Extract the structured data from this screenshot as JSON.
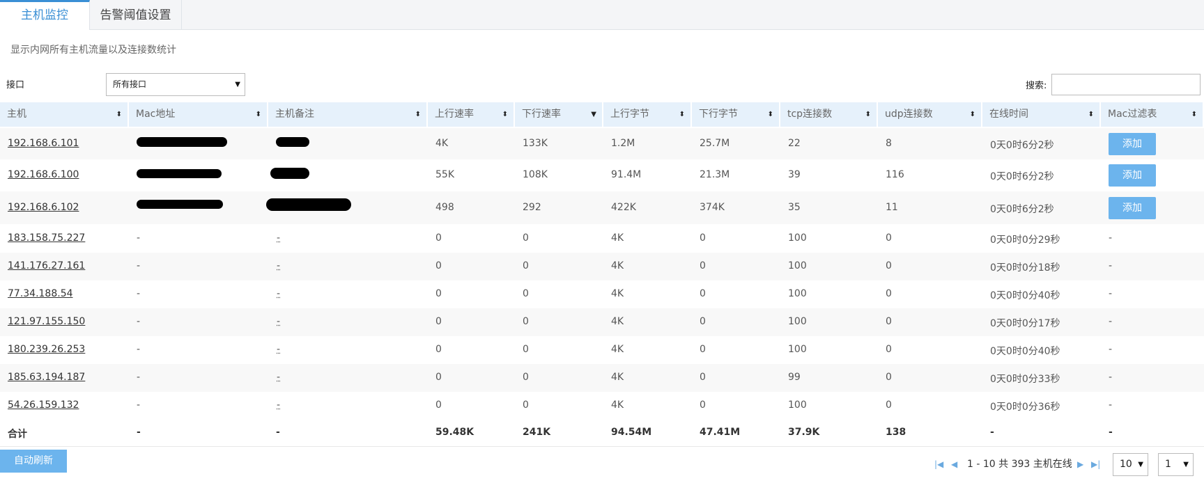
{
  "tabs": [
    {
      "label": "主机监控",
      "active": true
    },
    {
      "label": "告警阈值设置",
      "active": false
    }
  ],
  "description": "显示内网所有主机流量以及连接数统计",
  "filters": {
    "interface_label": "接口",
    "interface_value": "所有接口",
    "search_label": "搜索:",
    "search_value": ""
  },
  "columns": [
    "主机",
    "Mac地址",
    "主机备注",
    "上行速率",
    "下行速率",
    "上行字节",
    "下行字节",
    "tcp连接数",
    "udp连接数",
    "在线时间",
    "Mac过滤表"
  ],
  "rows": [
    {
      "host": "192.168.6.101",
      "mac": "",
      "note": "",
      "up_rate": "4K",
      "down_rate": "133K",
      "up_bytes": "1.2M",
      "down_bytes": "25.7M",
      "tcp": "22",
      "udp": "8",
      "online": "0天0时6分2秒",
      "mac_filter": "添加"
    },
    {
      "host": "192.168.6.100",
      "mac": "",
      "note": "",
      "up_rate": "55K",
      "down_rate": "108K",
      "up_bytes": "91.4M",
      "down_bytes": "21.3M",
      "tcp": "39",
      "udp": "116",
      "online": "0天0时6分2秒",
      "mac_filter": "添加"
    },
    {
      "host": "192.168.6.102",
      "mac": "",
      "note": "",
      "up_rate": "498",
      "down_rate": "292",
      "up_bytes": "422K",
      "down_bytes": "374K",
      "tcp": "35",
      "udp": "11",
      "online": "0天0时6分2秒",
      "mac_filter": "添加"
    },
    {
      "host": "183.158.75.227",
      "mac": "-",
      "note": "-",
      "up_rate": "0",
      "down_rate": "0",
      "up_bytes": "4K",
      "down_bytes": "0",
      "tcp": "100",
      "udp": "0",
      "online": "0天0时0分29秒",
      "mac_filter": "-"
    },
    {
      "host": "141.176.27.161",
      "mac": "-",
      "note": "-",
      "up_rate": "0",
      "down_rate": "0",
      "up_bytes": "4K",
      "down_bytes": "0",
      "tcp": "100",
      "udp": "0",
      "online": "0天0时0分18秒",
      "mac_filter": "-"
    },
    {
      "host": "77.34.188.54",
      "mac": "-",
      "note": "-",
      "up_rate": "0",
      "down_rate": "0",
      "up_bytes": "4K",
      "down_bytes": "0",
      "tcp": "100",
      "udp": "0",
      "online": "0天0时0分40秒",
      "mac_filter": "-"
    },
    {
      "host": "121.97.155.150",
      "mac": "-",
      "note": "-",
      "up_rate": "0",
      "down_rate": "0",
      "up_bytes": "4K",
      "down_bytes": "0",
      "tcp": "100",
      "udp": "0",
      "online": "0天0时0分17秒",
      "mac_filter": "-"
    },
    {
      "host": "180.239.26.253",
      "mac": "-",
      "note": "-",
      "up_rate": "0",
      "down_rate": "0",
      "up_bytes": "4K",
      "down_bytes": "0",
      "tcp": "100",
      "udp": "0",
      "online": "0天0时0分40秒",
      "mac_filter": "-"
    },
    {
      "host": "185.63.194.187",
      "mac": "-",
      "note": "-",
      "up_rate": "0",
      "down_rate": "0",
      "up_bytes": "4K",
      "down_bytes": "0",
      "tcp": "99",
      "udp": "0",
      "online": "0天0时0分33秒",
      "mac_filter": "-"
    },
    {
      "host": "54.26.159.132",
      "mac": "-",
      "note": "-",
      "up_rate": "0",
      "down_rate": "0",
      "up_bytes": "4K",
      "down_bytes": "0",
      "tcp": "100",
      "udp": "0",
      "online": "0天0时0分36秒",
      "mac_filter": "-"
    }
  ],
  "totals": {
    "label": "合计",
    "mac": "-",
    "note": "-",
    "up_rate": "59.48K",
    "down_rate": "241K",
    "up_bytes": "94.54M",
    "down_bytes": "47.41M",
    "tcp": "37.9K",
    "udp": "138",
    "online": "-",
    "mac_filter": "-"
  },
  "footer": {
    "auto_refresh_label": "自动刷新",
    "pagination_text": "1 - 10 共 393 主机在线",
    "page_size": "10",
    "page_number": "1"
  },
  "colors": {
    "accent": "#3a8fd5",
    "header_bg": "#e6f1fb",
    "button_bg": "#6cb4ed"
  }
}
